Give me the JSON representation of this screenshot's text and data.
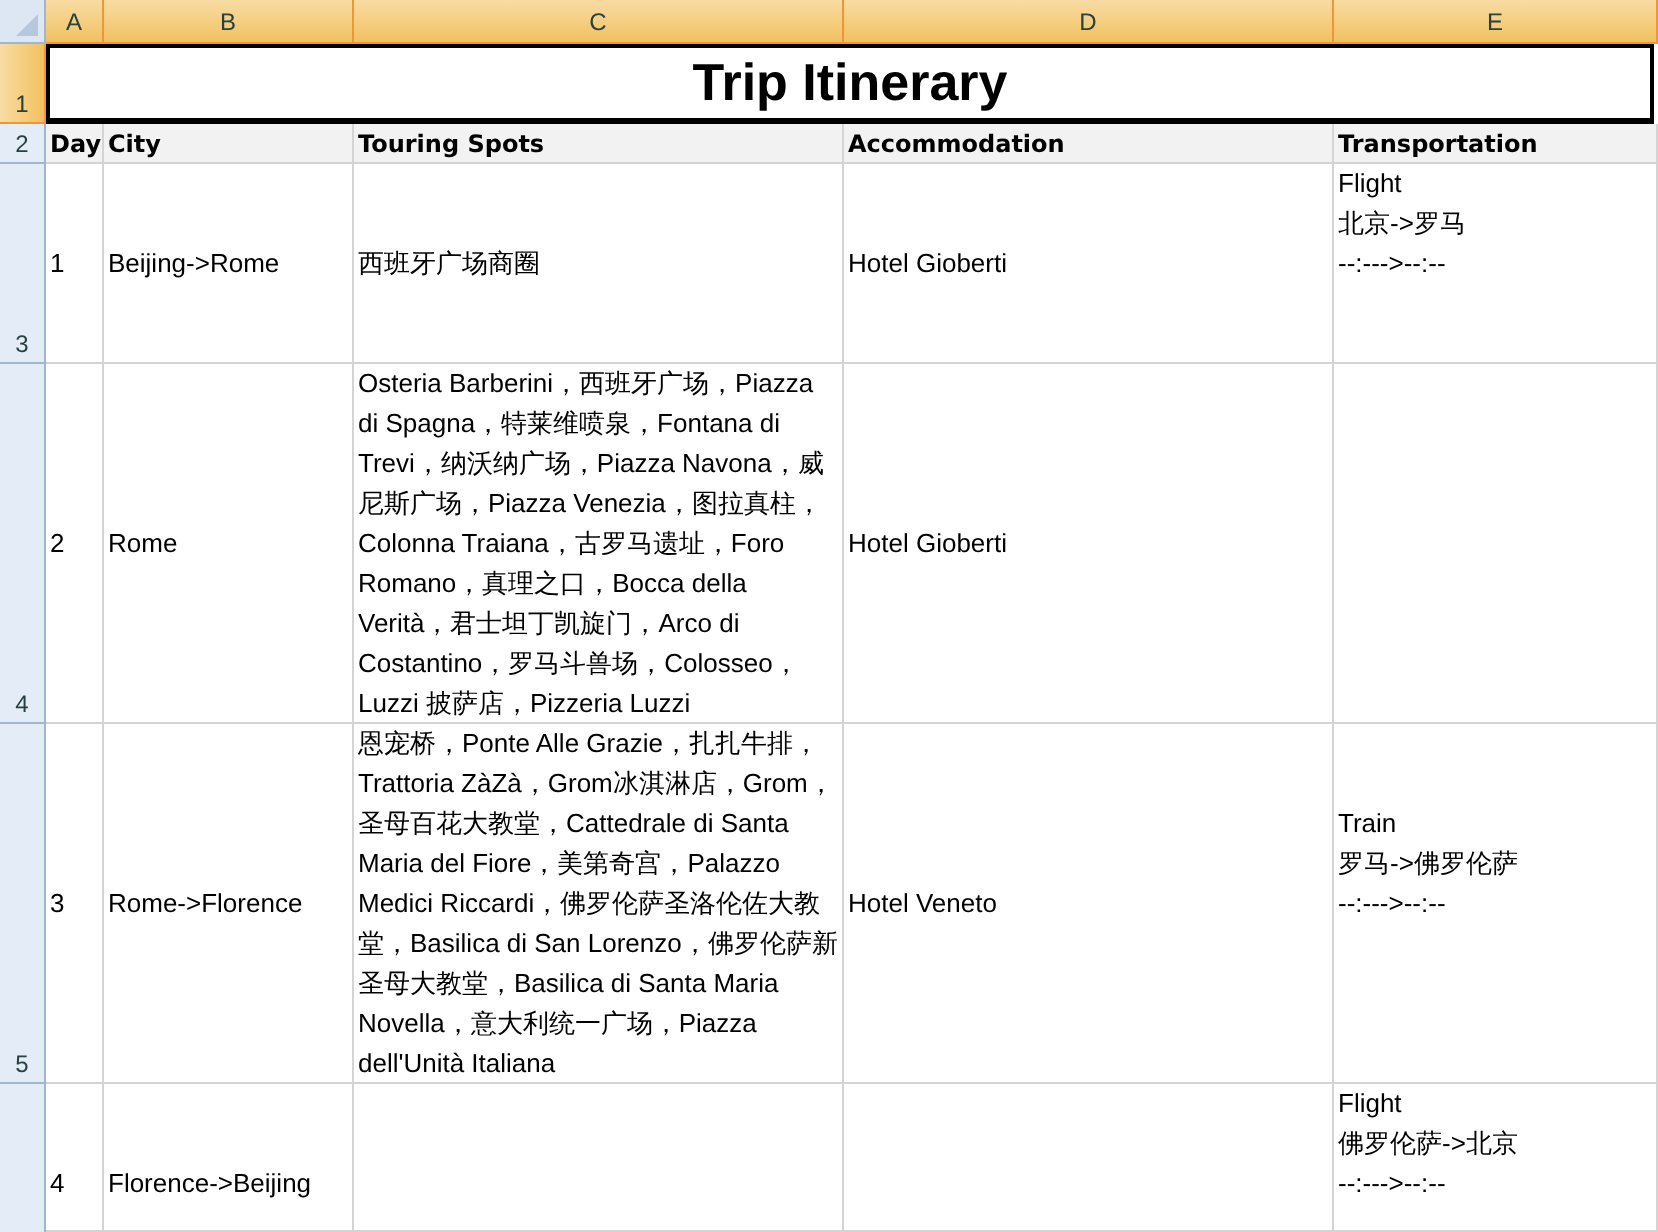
{
  "column_headers": [
    {
      "label": "A",
      "selected": true
    },
    {
      "label": "B",
      "selected": true
    },
    {
      "label": "C",
      "selected": true
    },
    {
      "label": "D",
      "selected": true
    },
    {
      "label": "E",
      "selected": true
    }
  ],
  "row_headers": [
    {
      "label": "1",
      "selected": true
    },
    {
      "label": "2",
      "selected": false
    },
    {
      "label": "3",
      "selected": false
    },
    {
      "label": "4",
      "selected": false
    },
    {
      "label": "5",
      "selected": false
    }
  ],
  "title": "Trip Itinerary",
  "header_row": [
    "Day",
    "City",
    "Touring Spots",
    "Accommodation",
    "Transportation"
  ],
  "rows": [
    {
      "day": "1",
      "city": "Beijing->Rome",
      "touring_spots": "西班牙广场商圈",
      "accommodation": "Hotel Gioberti",
      "transportation": "Flight\n北京->罗马\n--:--->--:--"
    },
    {
      "day": "2",
      "city": "Rome",
      "touring_spots": "Osteria Barberini，西班牙广场，Piazza di Spagna，特莱维喷泉，Fontana di Trevi，纳沃纳广场，Piazza Navona，威尼斯广场，Piazza Venezia，图拉真柱，Colonna Traiana，古罗马遗址，Foro Romano，真理之口，Bocca della Verità，君士坦丁凯旋门，Arco di Costantino，罗马斗兽场，Colosseo，Luzzi 披萨店，Pizzeria Luzzi",
      "accommodation": "Hotel Gioberti"
    },
    {
      "day": "3",
      "city": "Rome->Florence",
      "touring_spots": "恩宠桥，Ponte Alle Grazie，扎扎牛排，Trattoria ZàZà，Grom冰淇淋店，Grom，圣母百花大教堂，Cattedrale di Santa Maria del Fiore，美第奇宫，Palazzo Medici Riccardi，佛罗伦萨圣洛伦佐大教堂，Basilica di San Lorenzo，佛罗伦萨新圣母大教堂，Basilica di Santa Maria Novella，意大利统一广场，Piazza dell'Unità Italiana",
      "accommodation": "Hotel Veneto",
      "transportation": "Train\n罗马->佛罗伦萨\n--:--->--:--"
    },
    {
      "day": "4",
      "city": "Florence->Beijing",
      "transportation": "Flight\n佛罗伦萨->北京\n--:--->--:--"
    }
  ]
}
